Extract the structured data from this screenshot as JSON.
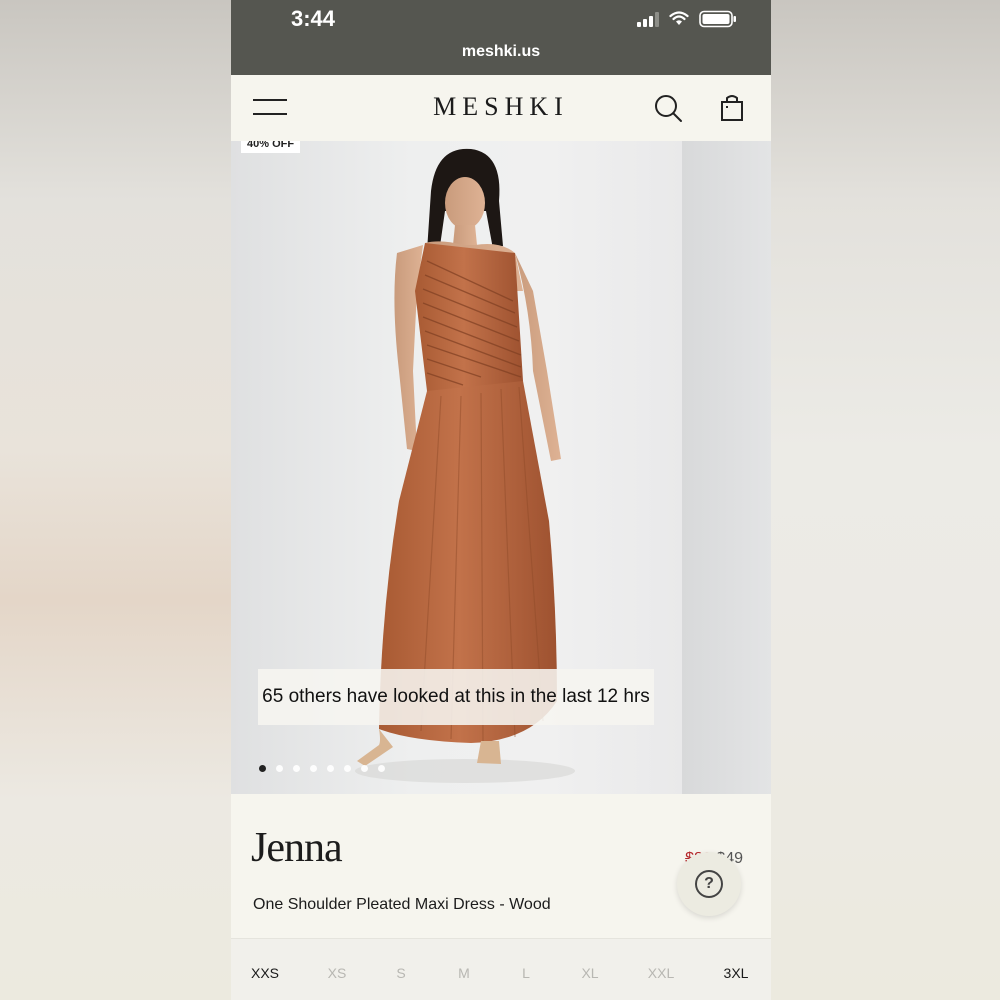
{
  "status_bar": {
    "time": "3:44",
    "url": "meshki.us"
  },
  "header": {
    "logo": "MESHKI"
  },
  "gallery": {
    "badge": "40% OFF",
    "views_banner": "65 others have looked at this in the last 12 hrs",
    "slide_count": 8,
    "active_slide": 1
  },
  "product": {
    "name": "Jenna",
    "subtitle": "One Shoulder Pleated Maxi Dress - Wood",
    "price_original": "$89",
    "price_sale": "$49"
  },
  "sizes": [
    {
      "label": "XXS",
      "available": true
    },
    {
      "label": "XS",
      "available": false
    },
    {
      "label": "S",
      "available": false
    },
    {
      "label": "M",
      "available": false
    },
    {
      "label": "L",
      "available": false
    },
    {
      "label": "XL",
      "available": false
    },
    {
      "label": "XXL",
      "available": false
    },
    {
      "label": "3XL",
      "available": true
    }
  ],
  "colors": {
    "status_bar": "#555650",
    "sale_red": "#b5262a",
    "dress": "#b8673d"
  }
}
